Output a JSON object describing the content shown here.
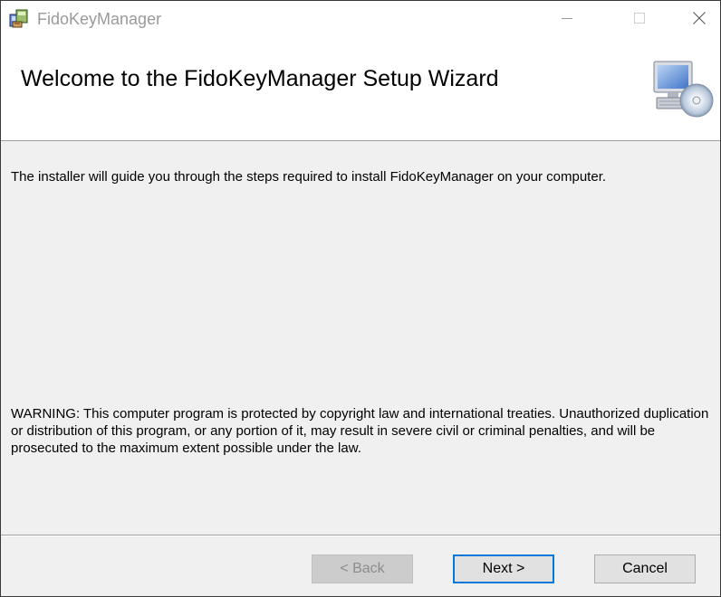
{
  "window": {
    "title": "FidoKeyManager",
    "controls": {
      "minimize": "minimize-icon",
      "maximize": "maximize-icon",
      "close": "close-icon"
    }
  },
  "header": {
    "title": "Welcome to the FidoKeyManager Setup Wizard",
    "graphic": "computer-disc-icon"
  },
  "body": {
    "intro": "The installer will guide you through the steps required to install FidoKeyManager on your computer.",
    "warning": "WARNING: This computer program is protected by copyright law and international treaties. Unauthorized duplication or distribution of this program, or any portion of it, may result in severe civil or criminal penalties, and will be prosecuted to the maximum extent possible under the law."
  },
  "buttons": {
    "back": "< Back",
    "next": "Next >",
    "cancel": "Cancel"
  },
  "colors": {
    "focus_border": "#0078d7",
    "dialog_bg": "#f0f0f0",
    "disabled_text": "#8c8c8c"
  }
}
